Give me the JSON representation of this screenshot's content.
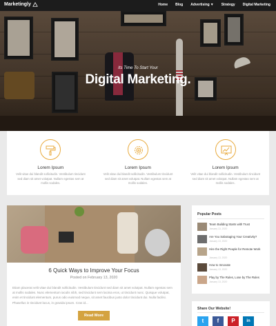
{
  "brand": {
    "name": "Marketingly",
    "accent": "#d4a340"
  },
  "nav": {
    "items": [
      {
        "label": "Home"
      },
      {
        "label": "Blog"
      },
      {
        "label": "Advertising"
      },
      {
        "label": "Strategy"
      },
      {
        "label": "Digital Marketing"
      }
    ]
  },
  "hero": {
    "subtitle": "Its Time To Start Your",
    "title": "Digital Marketing."
  },
  "features": [
    {
      "icon": "paint-roller-icon",
      "title": "Lorem Ipsum",
      "text": "Velit vitae dui blandit sollicitudin. Vestibulum tincidunt sed diam sit amet volutpat. Nullam egestas sem at mollis sodales."
    },
    {
      "icon": "gear-icon",
      "title": "Lorem Ipsum",
      "text": "Velit vitae dui blandit sollicitudin. Vestibulum tincidunt sed diam sit amet volutpat. Nullam egestas sem at mollis sodales."
    },
    {
      "icon": "growth-chart-icon",
      "title": "Lorem Ipsum",
      "text": "Velit vitae dui blandit sollicitudin. Vestibulum tincidunt sed diam sit amet volutpat. Nullam egestas sem at mollis sodales."
    }
  ],
  "post": {
    "title": "6 Quick Ways to Improve Your Focus",
    "date": "Posted on February 13, 2020",
    "excerpt": "Etiam placerat velit vitae dui blandit sollicitudin. Vestibulum tincidunt sed diam sit amet volutpat. Nullam egestas sem at mollis sodales. Nunc elementum iaculis nibh, sed tincidunt sem lacinia eros, ut tincidunt nunc. Quisque volutpat, enim et tincidunt elementum, purus odio euismod neque, sit amet faucibus justo dolor tincidunt dui. Nulla facilisi. Phasellus in tincidunt lacus, in gravida ipsum. Cras id...",
    "button": "Read More"
  },
  "sidebar": {
    "title": "Popular Posts",
    "posts": [
      {
        "title": "Team Building Starts with Trust",
        "date": "January 13, 2020"
      },
      {
        "title": "Are You Sabotaging Your Creativity?",
        "date": "January 13, 2020"
      },
      {
        "title": "Hire the Right People for Remote Work",
        "date": "January 13, 2020"
      },
      {
        "title": "How to Innovate",
        "date": "January 13, 2020"
      },
      {
        "title": "Play by The Rules, Lose by The Rules",
        "date": "January 13, 2020"
      }
    ]
  },
  "share": {
    "title": "Share Our Website!",
    "buttons": [
      {
        "label": "t",
        "color": "#2aa3ef",
        "icon": "twitter-icon"
      },
      {
        "label": "f",
        "color": "#3b5998",
        "icon": "facebook-icon"
      },
      {
        "label": "P",
        "color": "#cb2027",
        "icon": "pinterest-icon"
      },
      {
        "label": "in",
        "color": "#0077b5",
        "icon": "linkedin-icon"
      }
    ]
  }
}
